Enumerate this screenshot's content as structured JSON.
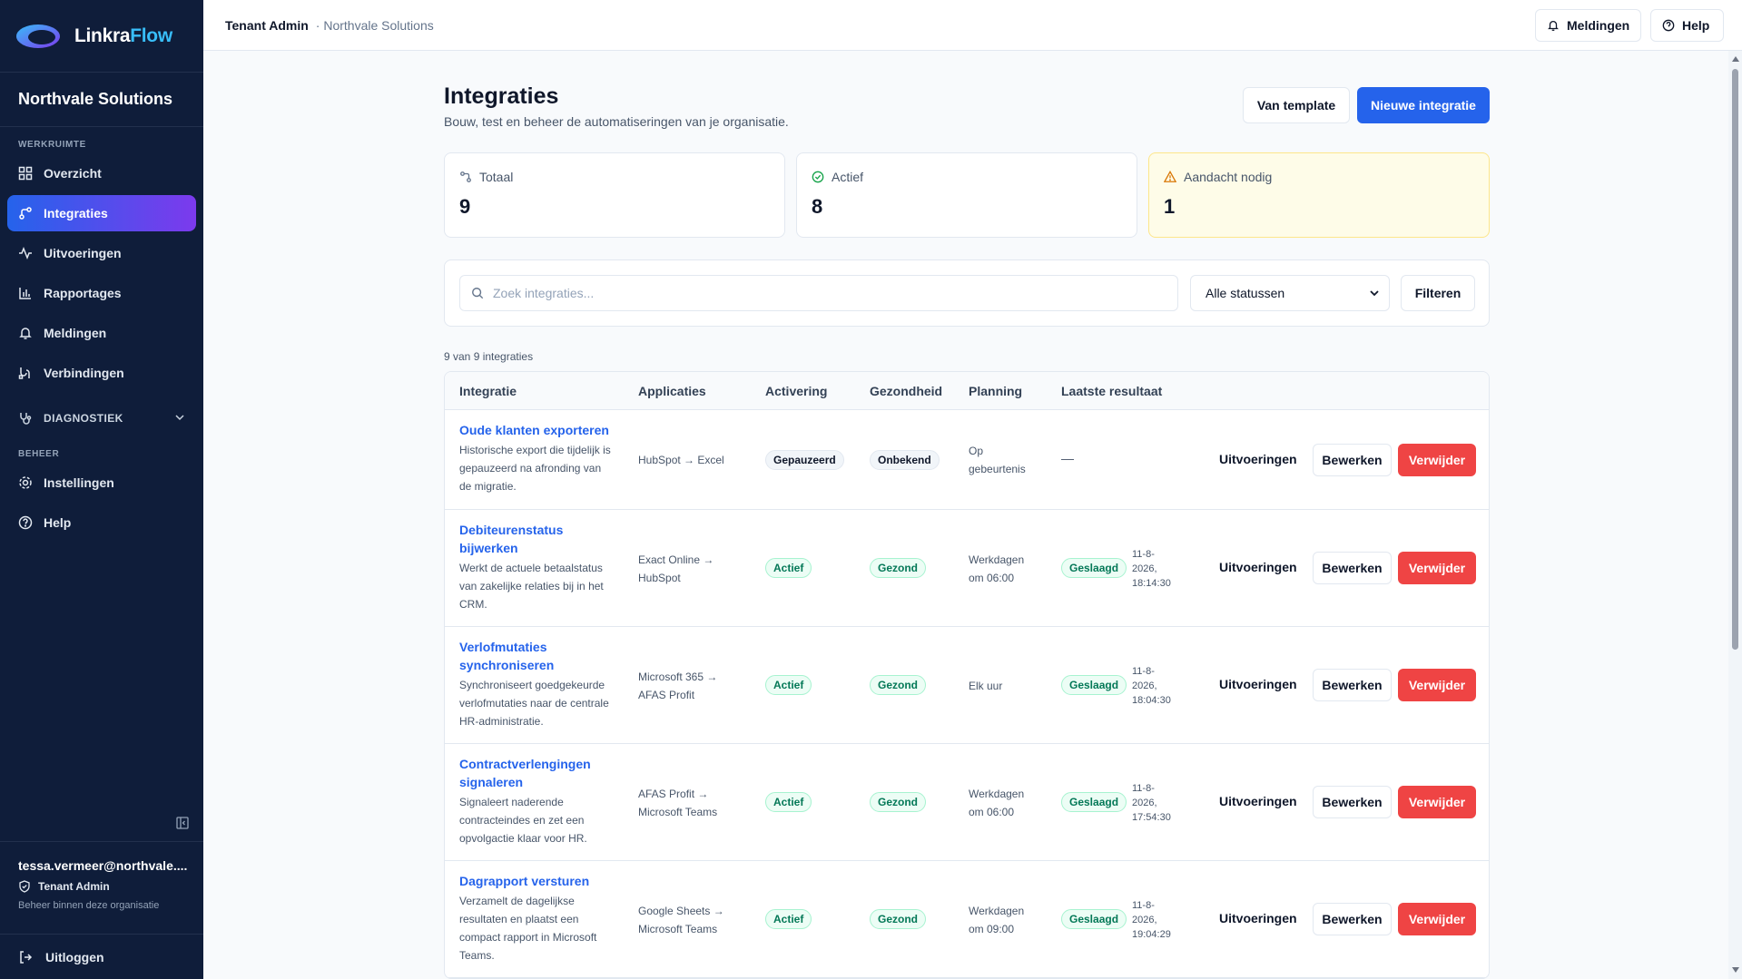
{
  "app": {
    "logo_part1": "Linkra",
    "logo_part2": "Flow",
    "brand_color": "#2563eb"
  },
  "sidebar": {
    "tenant_name": "Northvale Solutions",
    "section_workspace": "WERKRUIMTE",
    "items": [
      {
        "label": "Overzicht",
        "icon": "grid-icon"
      },
      {
        "label": "Integraties",
        "icon": "integration-icon",
        "active": true
      },
      {
        "label": "Uitvoeringen",
        "icon": "activity-icon"
      },
      {
        "label": "Rapportages",
        "icon": "bar-chart-icon"
      },
      {
        "label": "Meldingen",
        "icon": "bell-icon"
      },
      {
        "label": "Verbindingen",
        "icon": "connections-icon"
      }
    ],
    "diagnostics_label": "DIAGNOSTIEK",
    "section_manage": "BEHEER",
    "manage_items": [
      {
        "label": "Instellingen",
        "icon": "gear-icon"
      },
      {
        "label": "Help",
        "icon": "help-icon"
      }
    ],
    "user_email": "tessa.vermeer@northvale....",
    "user_role": "Tenant Admin",
    "user_note": "Beheer binnen deze organisatie",
    "logout_label": "Uitloggen"
  },
  "topbar": {
    "breadcrumb_role": "Tenant Admin",
    "breadcrumb_tenant": "· Northvale Solutions",
    "notifications_label": "Meldingen",
    "help_label": "Help"
  },
  "page": {
    "title": "Integraties",
    "subtitle": "Bouw, test en beheer de automatiseringen van je organisatie.",
    "template_button": "Van template",
    "new_button": "Nieuwe integratie"
  },
  "stats": [
    {
      "label": "Totaal",
      "value": "9"
    },
    {
      "label": "Actief",
      "value": "8"
    },
    {
      "label": "Aandacht nodig",
      "value": "1"
    }
  ],
  "filters": {
    "search_placeholder": "Zoek integraties...",
    "status_selected": "Alle statussen",
    "filter_button": "Filteren"
  },
  "result_count": "9 van 9 integraties",
  "table": {
    "headers": [
      "Integratie",
      "Applicaties",
      "Activering",
      "Gezondheid",
      "Planning",
      "Laatste resultaat"
    ],
    "rows": [
      {
        "name": "Oude klanten exporteren",
        "description": "Historische export die tijdelijk is gepauzeerd na afronding van de migratie.",
        "apps": "HubSpot → Excel",
        "activation": "Gepauzeerd",
        "health": "Onbekend",
        "planning": "Op gebeurtenis",
        "result": "",
        "result_time": "",
        "result_empty": "—",
        "runs_label": "Uitvoeringen",
        "edit_label": "Bewerken",
        "delete_label": "Verwijder"
      },
      {
        "name": "Debiteurenstatus bijwerken",
        "description": "Werkt de actuele betaalstatus van zakelijke relaties bij in het CRM.",
        "apps": "Exact Online → HubSpot",
        "activation": "Actief",
        "health": "Gezond",
        "planning": "Werkdagen om 06:00",
        "result": "Geslaagd",
        "result_time": "11-8-2026, 18:14:30",
        "runs_label": "Uitvoeringen",
        "edit_label": "Bewerken",
        "delete_label": "Verwijder"
      },
      {
        "name": "Verlofmutaties synchroniseren",
        "description": "Synchroniseert goedgekeurde verlofmutaties naar de centrale HR-administratie.",
        "apps": "Microsoft 365 → AFAS Profit",
        "activation": "Actief",
        "health": "Gezond",
        "planning": "Elk uur",
        "result": "Geslaagd",
        "result_time": "11-8-2026, 18:04:30",
        "runs_label": "Uitvoeringen",
        "edit_label": "Bewerken",
        "delete_label": "Verwijder"
      },
      {
        "name": "Contractverlengingen signaleren",
        "description": "Signaleert naderende contracteindes en zet een opvolgactie klaar voor HR.",
        "apps": "AFAS Profit → Microsoft Teams",
        "activation": "Actief",
        "health": "Gezond",
        "planning": "Werkdagen om 06:00",
        "result": "Geslaagd",
        "result_time": "11-8-2026, 17:54:30",
        "runs_label": "Uitvoeringen",
        "edit_label": "Bewerken",
        "delete_label": "Verwijder"
      },
      {
        "name": "Dagrapport versturen",
        "description": "Verzamelt de dagelijkse resultaten en plaatst een compact rapport in Microsoft Teams.",
        "apps": "Google Sheets → Microsoft Teams",
        "activation": "Actief",
        "health": "Gezond",
        "planning": "Werkdagen om 09:00",
        "result": "Geslaagd",
        "result_time": "11-8-2026, 19:04:29",
        "runs_label": "Uitvoeringen",
        "edit_label": "Bewerken",
        "delete_label": "Verwijder"
      }
    ]
  }
}
